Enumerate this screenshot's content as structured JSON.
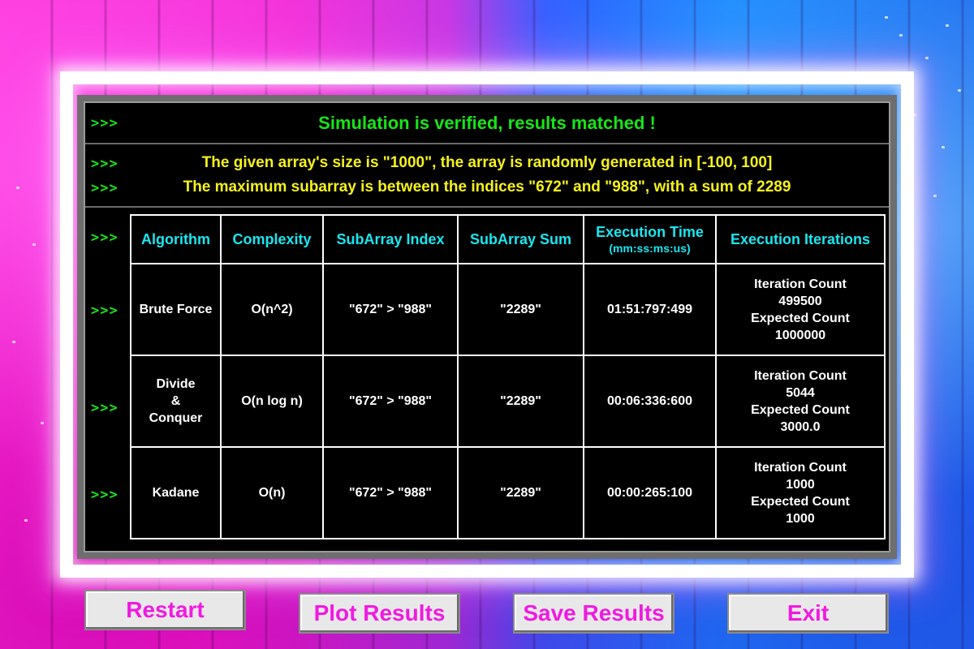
{
  "prompt_symbol": ">>>",
  "status_message": "Simulation is verified, results matched !",
  "info_lines": [
    "The given array's size is \"1000\", the array is randomly generated in [-100, 100]",
    "The maximum subarray is between the indices \"672\" and \"988\", with a sum of 2289"
  ],
  "table": {
    "headers": {
      "algorithm": "Algorithm",
      "complexity": "Complexity",
      "subarray_index": "SubArray Index",
      "subarray_sum": "SubArray Sum",
      "execution_time": "Execution Time",
      "execution_time_unit": "(mm:ss:ms:us)",
      "execution_iterations": "Execution Iterations"
    },
    "rows": [
      {
        "algorithm": [
          "Brute Force"
        ],
        "complexity": "O(n^2)",
        "subarray_index": "\"672\" > \"988\"",
        "subarray_sum": "\"2289\"",
        "execution_time": "01:51:797:499",
        "iteration_label": "Iteration Count",
        "iteration_count": "499500",
        "expected_label": "Expected Count",
        "expected_count": "1000000"
      },
      {
        "algorithm": [
          "Divide",
          "&",
          "Conquer"
        ],
        "complexity": "O(n log n)",
        "subarray_index": "\"672\" > \"988\"",
        "subarray_sum": "\"2289\"",
        "execution_time": "00:06:336:600",
        "iteration_label": "Iteration Count",
        "iteration_count": "5044",
        "expected_label": "Expected Count",
        "expected_count": "3000.0"
      },
      {
        "algorithm": [
          "Kadane"
        ],
        "complexity": "O(n)",
        "subarray_index": "\"672\" > \"988\"",
        "subarray_sum": "\"2289\"",
        "execution_time": "00:00:265:100",
        "iteration_label": "Iteration Count",
        "iteration_count": "1000",
        "expected_label": "Expected Count",
        "expected_count": "1000"
      }
    ]
  },
  "buttons": {
    "restart": "Restart",
    "plot": "Plot Results",
    "save": "Save Results",
    "exit": "Exit"
  },
  "colors": {
    "status_text": "#17e617",
    "info_text": "#f5f21a",
    "header_text": "#19e6f0",
    "button_text": "#f01ae0",
    "button_bg": "#e8e8e8",
    "panel_bg": "#000000"
  }
}
